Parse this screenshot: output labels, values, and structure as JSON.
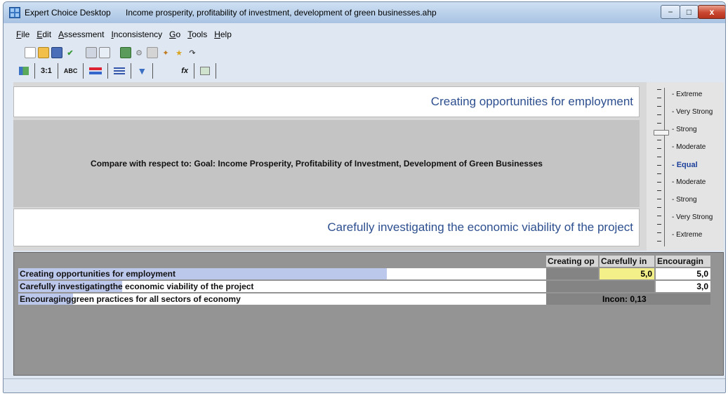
{
  "window": {
    "app_name": "Expert Choice Desktop",
    "document_name": "Income prosperity, profitability of investment, development of green businesses.ahp",
    "min_glyph": "−",
    "max_glyph": "□",
    "close_glyph": "x"
  },
  "menu": [
    "File",
    "Edit",
    "Assessment",
    "Inconsistency",
    "Go",
    "Tools",
    "Help"
  ],
  "toolbar2": {
    "tabs": [
      "",
      "3:1",
      "ABC",
      "",
      "",
      "",
      "fx",
      ""
    ]
  },
  "comparison": {
    "top_element": "Creating opportunities for employment",
    "bottom_element": "Carefully investigating the economic viability of the project",
    "compare_text": "Compare with respect to: Goal: Income Prosperity, Profitability of Investment, Development of Green Businesses"
  },
  "scale": {
    "labels": [
      "- Extreme",
      "- Very Strong",
      "- Strong",
      "- Moderate",
      "- Equal",
      "- Moderate",
      "- Strong",
      "- Very Strong",
      "- Extreme"
    ],
    "selected": "Strong"
  },
  "matrix": {
    "col_headers": [
      "Creating op",
      "Carefully in",
      "Encouragin"
    ],
    "rows": [
      {
        "bold": "Creating opportunities for employment",
        "rest": ""
      },
      {
        "bold": "Carefully investigating",
        "rest": " the economic viability of the project"
      },
      {
        "bold": "Encouraging",
        "rest": " green practices for all sectors of economy"
      }
    ],
    "values": {
      "r1c2": "5,0",
      "r1c3": "5,0",
      "r2c3": "3,0"
    },
    "inconsistency": "Incon: 0,13"
  },
  "colors": {
    "accent_text": "#2d4f8f",
    "selected_cell": "#f3f08a",
    "row_highlight": "#bcc7ec"
  }
}
